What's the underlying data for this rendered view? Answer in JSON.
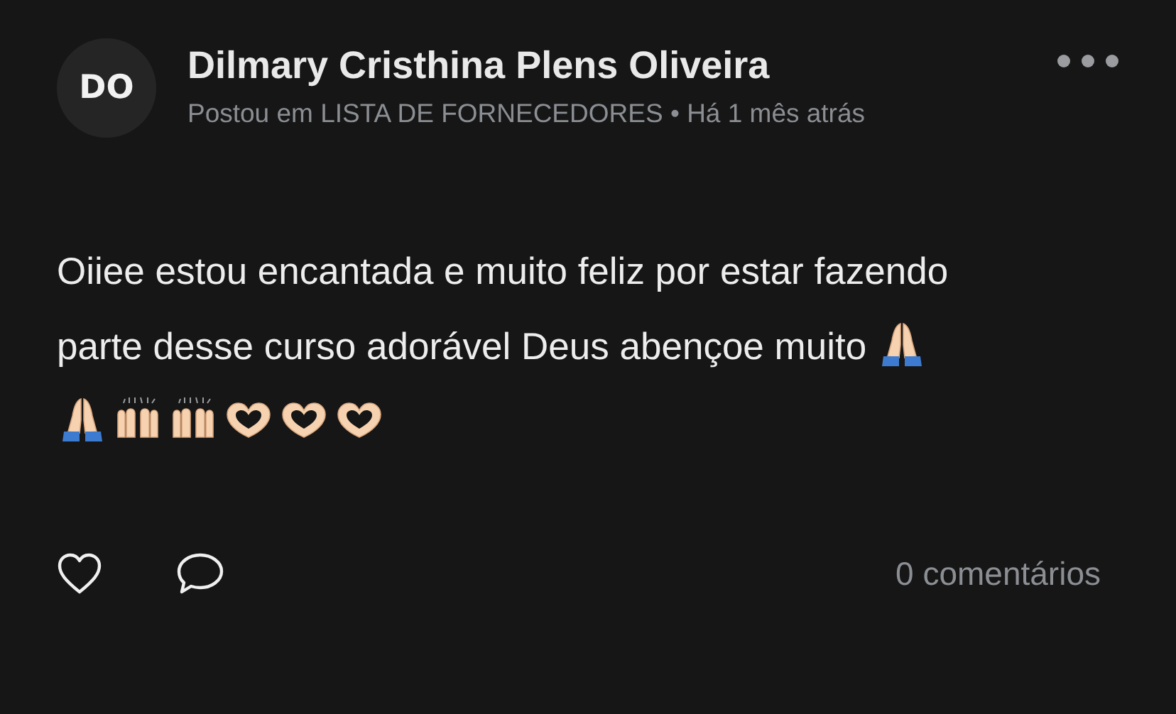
{
  "post": {
    "avatar": "DO",
    "author": "Dilmary Cristhina Plens Oliveira",
    "meta": "Postou em LISTA DE FORNECEDORES • Há 1 mês atrás",
    "text_lines": [
      "Oiiee estou encantada e muito feliz por estar fazendo",
      "parte desse curso adorável Deus abençoe muito"
    ],
    "emoji_groups": [
      [
        {
          "kind": "pray"
        }
      ],
      [
        {
          "kind": "pray"
        },
        {
          "kind": "raised-hands"
        },
        {
          "kind": "raised-hands"
        },
        {
          "kind": "heart-hands"
        },
        {
          "kind": "heart-hands"
        },
        {
          "kind": "heart-hands"
        }
      ]
    ],
    "comments": "0 comentários"
  }
}
